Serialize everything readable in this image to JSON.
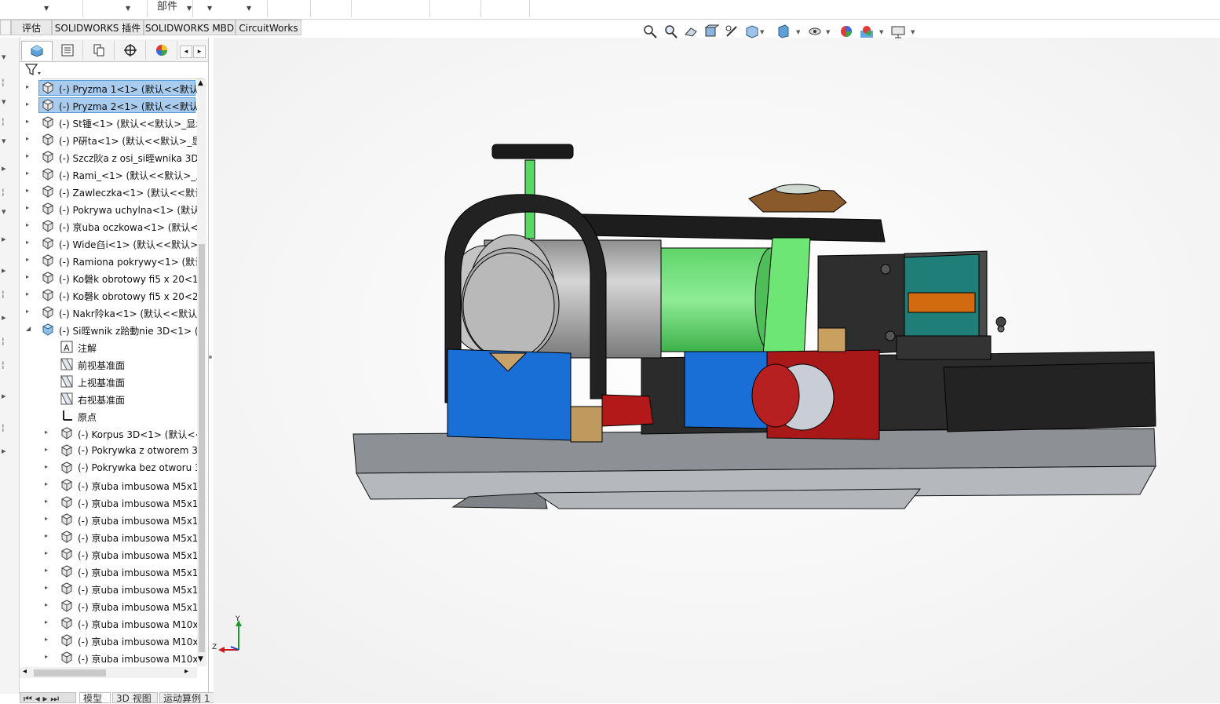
{
  "ribbon": {
    "label": "部件"
  },
  "tabs": [
    {
      "label": "评估"
    },
    {
      "label": "SOLIDWORKS 插件"
    },
    {
      "label": "SOLIDWORKS MBD"
    },
    {
      "label": "CircuitWorks"
    }
  ],
  "feature_manager": {
    "tree": [
      {
        "label": "(-) Pryzma 1<1> (默认<<默认>",
        "selected": true,
        "level": 0,
        "expander": "▸",
        "icon": "part-icon"
      },
      {
        "label": "(-) Pryzma 2<1> (默认<<默认>",
        "selected": true,
        "level": 0,
        "expander": "▸",
        "icon": "part-icon"
      },
      {
        "label": "(-) St锺<1> (默认<<默认>_显示",
        "selected": false,
        "level": 0,
        "expander": "▸",
        "icon": "part-icon"
      },
      {
        "label": "(-) P硏ta<1> (默认<<默认>_显",
        "selected": false,
        "level": 0,
        "expander": "▸",
        "icon": "part-icon"
      },
      {
        "label": "(-) Szcz阦a z osi_si晊wnika 3D",
        "selected": false,
        "level": 0,
        "expander": "▸",
        "icon": "part-icon"
      },
      {
        "label": "(-) Rami_<1> (默认<<默认>_显",
        "selected": false,
        "level": 0,
        "expander": "▸",
        "icon": "part-icon"
      },
      {
        "label": "(-) Zawleczka<1> (默认<<默认",
        "selected": false,
        "level": 0,
        "expander": "▸",
        "icon": "part-icon"
      },
      {
        "label": "(-) Pokrywa uchylna<1> (默认<",
        "selected": false,
        "level": 0,
        "expander": "▸",
        "icon": "part-icon"
      },
      {
        "label": "(-) 亰uba oczkowa<1> (默认<<",
        "selected": false,
        "level": 0,
        "expander": "▸",
        "icon": "part-icon"
      },
      {
        "label": "(-) Wide臽i<1> (默认<<默认>_",
        "selected": false,
        "level": 0,
        "expander": "▸",
        "icon": "part-icon"
      },
      {
        "label": "(-) Ramiona pokrywy<1> (默认",
        "selected": false,
        "level": 0,
        "expander": "▸",
        "icon": "part-icon"
      },
      {
        "label": "(-) Ko磬k obrotowy fi5 x 20<1",
        "selected": false,
        "level": 0,
        "expander": "▸",
        "icon": "part-icon"
      },
      {
        "label": "(-) Ko磬k obrotowy fi5 x 20<2",
        "selected": false,
        "level": 0,
        "expander": "▸",
        "icon": "part-icon"
      },
      {
        "label": "(-) Nakr阾ka<1> (默认<<默认>",
        "selected": false,
        "level": 0,
        "expander": "▸",
        "icon": "part-icon"
      },
      {
        "label": "(-) Si晊wnik z跲動nie 3D<1> (默",
        "selected": false,
        "level": 0,
        "expander": "◢",
        "icon": "assembly-icon"
      },
      {
        "label": "注解",
        "selected": false,
        "level": 1,
        "expander": "",
        "icon": "annotation-icon"
      },
      {
        "label": "前视基准面",
        "selected": false,
        "level": 1,
        "expander": "",
        "icon": "plane-icon"
      },
      {
        "label": "上视基准面",
        "selected": false,
        "level": 1,
        "expander": "",
        "icon": "plane-icon"
      },
      {
        "label": "右视基准面",
        "selected": false,
        "level": 1,
        "expander": "",
        "icon": "plane-icon"
      },
      {
        "label": "原点",
        "selected": false,
        "level": 1,
        "expander": "",
        "icon": "origin-icon"
      },
      {
        "label": "(-) Korpus 3D<1> (默认<<",
        "selected": false,
        "level": 1,
        "expander": "▸",
        "icon": "part-icon"
      },
      {
        "label": "(-) Pokrywka z otworem 3",
        "selected": false,
        "level": 1,
        "expander": "▸",
        "icon": "part-icon"
      },
      {
        "label": "(-) Pokrywka bez otworu 3",
        "selected": false,
        "level": 1,
        "expander": "▸",
        "icon": "part-icon"
      },
      {
        "label": "(-) 亰uba imbusowa M5x1",
        "selected": false,
        "level": 1,
        "expander": "▸",
        "icon": "part-icon"
      },
      {
        "label": "(-) 亰uba imbusowa M5x1",
        "selected": false,
        "level": 1,
        "expander": "▸",
        "icon": "part-icon"
      },
      {
        "label": "(-) 亰uba imbusowa M5x1",
        "selected": false,
        "level": 1,
        "expander": "▸",
        "icon": "part-icon"
      },
      {
        "label": "(-) 亰uba imbusowa M5x1",
        "selected": false,
        "level": 1,
        "expander": "▸",
        "icon": "part-icon"
      },
      {
        "label": "(-) 亰uba imbusowa M5x1",
        "selected": false,
        "level": 1,
        "expander": "▸",
        "icon": "part-icon"
      },
      {
        "label": "(-) 亰uba imbusowa M5x1",
        "selected": false,
        "level": 1,
        "expander": "▸",
        "icon": "part-icon"
      },
      {
        "label": "(-) 亰uba imbusowa M5x1",
        "selected": false,
        "level": 1,
        "expander": "▸",
        "icon": "part-icon"
      },
      {
        "label": "(-) 亰uba imbusowa M5x1",
        "selected": false,
        "level": 1,
        "expander": "▸",
        "icon": "part-icon"
      },
      {
        "label": "(-) 亰uba imbusowa M10x",
        "selected": false,
        "level": 1,
        "expander": "▸",
        "icon": "part-icon"
      },
      {
        "label": "(-) 亰uba imbusowa M10x",
        "selected": false,
        "level": 1,
        "expander": "▸",
        "icon": "part-icon"
      },
      {
        "label": "(-) 亰uba imbusowa M10x",
        "selected": false,
        "level": 1,
        "expander": "▸",
        "icon": "part-icon"
      }
    ]
  },
  "bottom_tabs": [
    {
      "label": "模型"
    },
    {
      "label": "3D 视图"
    },
    {
      "label": "运动算例 1"
    }
  ],
  "triad": {
    "y": "Y",
    "z": "Z"
  }
}
